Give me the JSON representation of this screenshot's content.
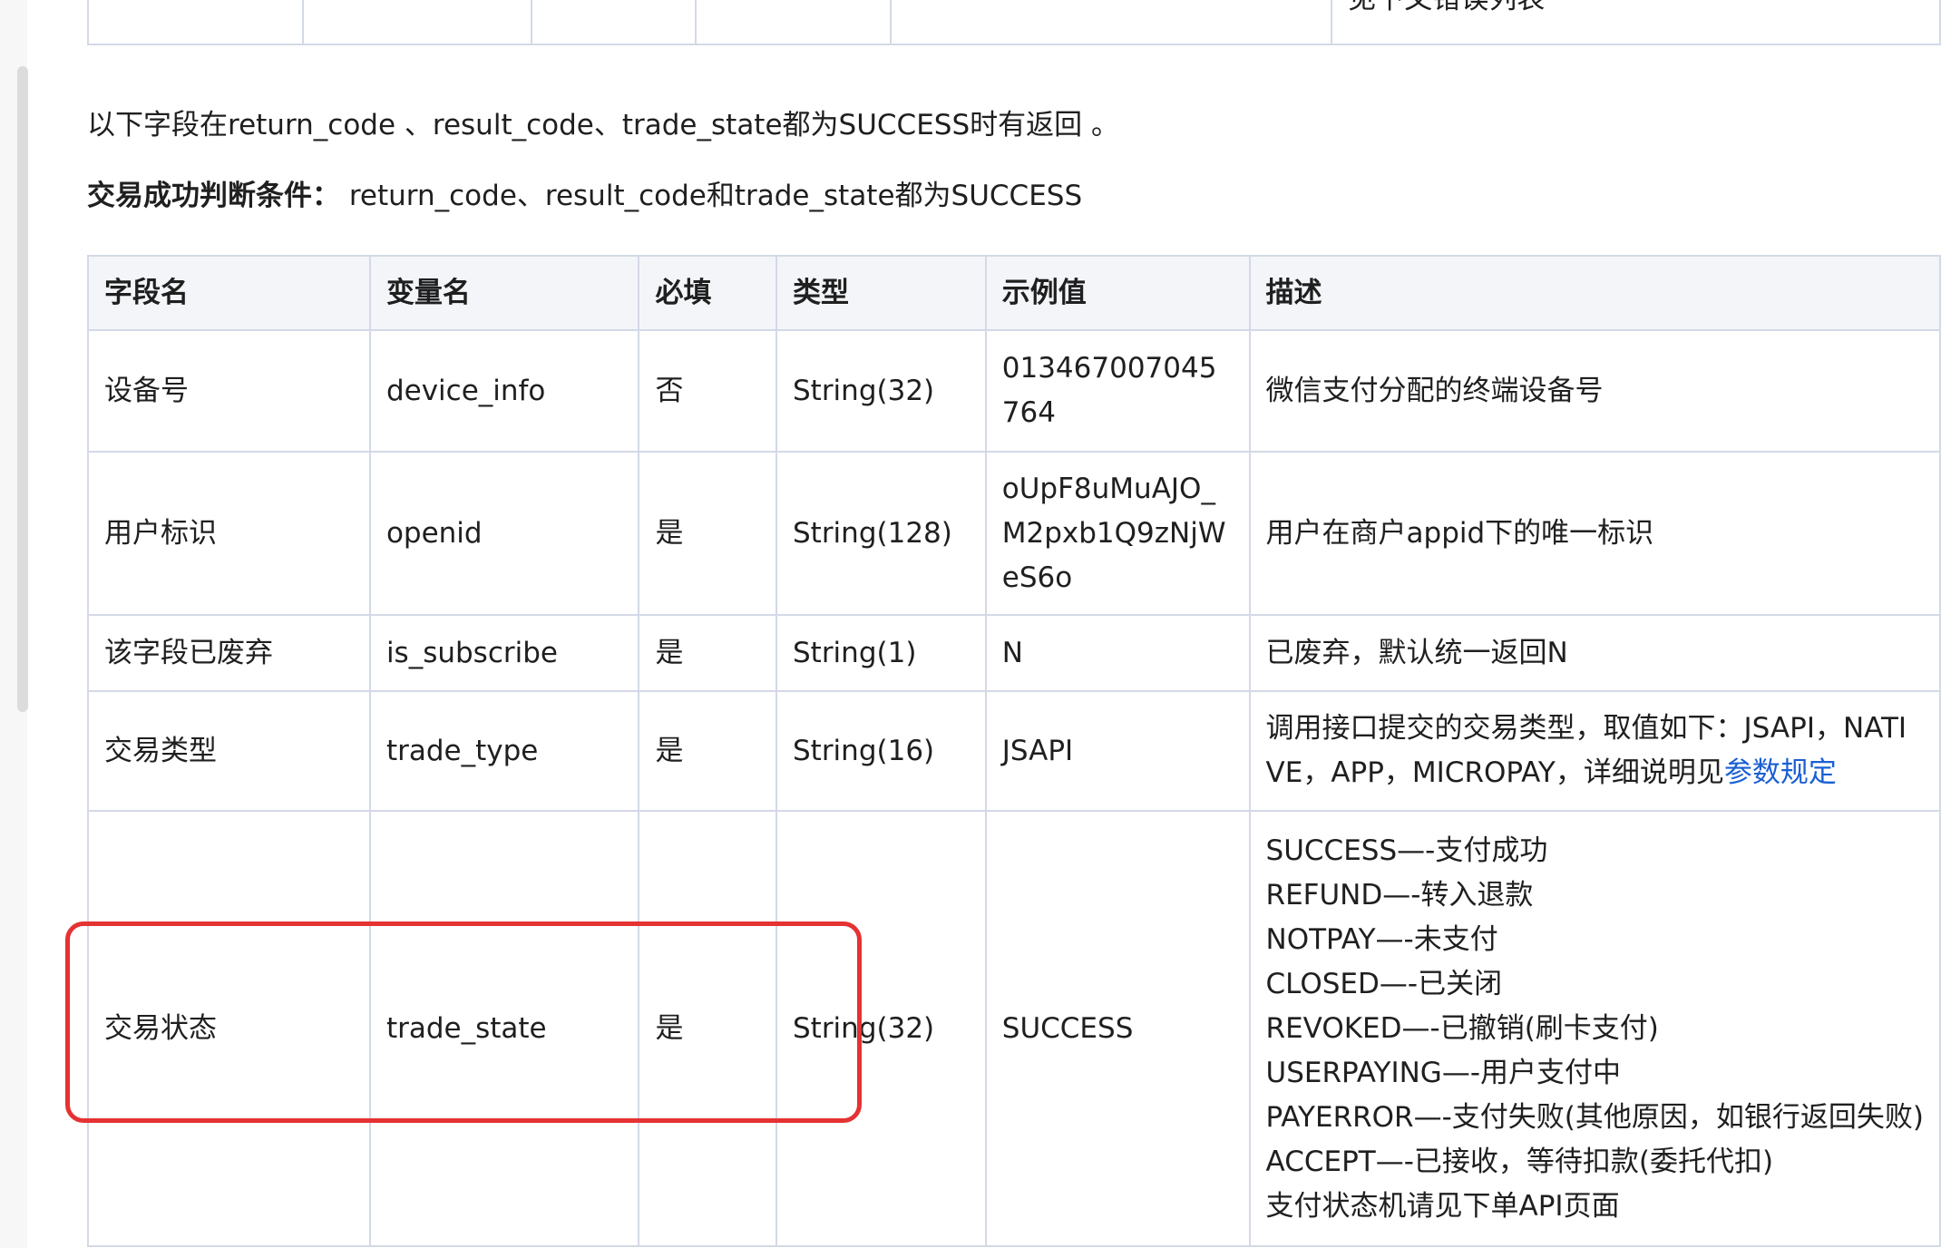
{
  "prev_table": {
    "error_text": "见下文错误列表"
  },
  "notes": {
    "line1": "以下字段在return_code 、result_code、trade_state都为SUCCESS时有返回 。",
    "line2_label": "交易成功判断条件：",
    "line2_text": " return_code、result_code和trade_state都为SUCCESS"
  },
  "table": {
    "headers": [
      "字段名",
      "变量名",
      "必填",
      "类型",
      "示例值",
      "描述"
    ],
    "rows": [
      {
        "field": "设备号",
        "var": "device_info",
        "required": "否",
        "type": "String(32)",
        "example": "013467007045764",
        "desc": "微信支付分配的终端设备号"
      },
      {
        "field": "用户标识",
        "var": "openid",
        "required": "是",
        "type": "String(128)",
        "example": "oUpF8uMuAJO_M2pxb1Q9zNjWeS6o",
        "desc": "用户在商户appid下的唯一标识"
      },
      {
        "field": "该字段已废弃",
        "var": "is_subscribe",
        "required": "是",
        "type": "String(1)",
        "example": "N",
        "desc": "已废弃，默认统一返回N"
      },
      {
        "field": "交易类型",
        "var": "trade_type",
        "required": "是",
        "type": "String(16)",
        "example": "JSAPI",
        "desc": "调用接口提交的交易类型，取值如下：JSAPI，NATIVE，APP，MICROPAY，详细说明见",
        "desc_link": "参数规定"
      },
      {
        "field": "交易状态",
        "var": "trade_state",
        "required": "是",
        "type": "String(32)",
        "example": "SUCCESS",
        "desc_lines": [
          "SUCCESS—-支付成功",
          "REFUND—-转入退款",
          "NOTPAY—-未支付",
          "CLOSED—-已关闭",
          "REVOKED—-已撤销(刷卡支付)",
          "USERPAYING—-用户支付中",
          "PAYERROR—-支付失败(其他原因，如银行返回失败)",
          "ACCEPT—-已接收，等待扣款(委托代扣)",
          "支付状态机请见下单API页面"
        ]
      }
    ]
  },
  "colors": {
    "highlight": "#e53232",
    "link": "#1a5fd4",
    "border": "#d3d9e6",
    "header_bg": "#f3f5f8"
  }
}
